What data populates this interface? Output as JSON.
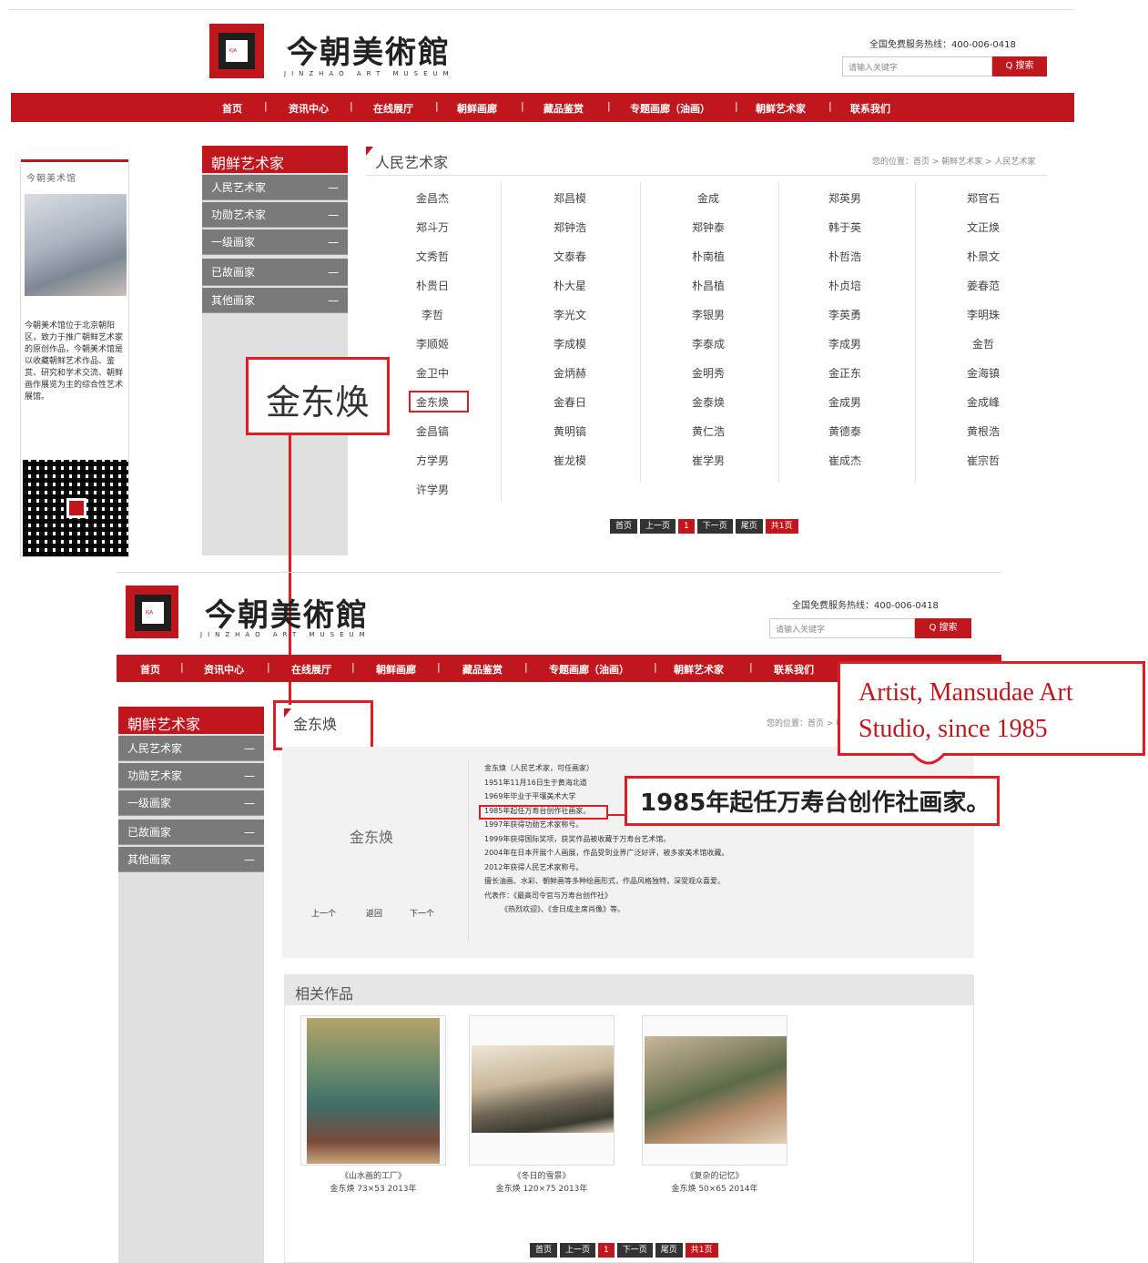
{
  "site": {
    "name": "今朝美術館",
    "name_sub": "JINZHAO ART MUSEUM",
    "logo_tag": "KJA",
    "hotline": "全国免费服务热线：400-006-0418",
    "search_placeholder": "请输入关键字",
    "search_button": "Q 搜索",
    "nav": [
      "首页",
      "资讯中心",
      "在线展厅",
      "朝鲜画廊",
      "藏品鉴赏",
      "专题画廊（油画）",
      "朝鲜艺术家",
      "联系我们"
    ]
  },
  "list_page": {
    "sidebar_title": "朝鲜艺术家",
    "sidebar_items": [
      "人民艺术家",
      "功勋艺术家",
      "一级画家",
      "已故画家",
      "其他画家"
    ],
    "content_title": "人民艺术家",
    "breadcrumb": "您的位置：首页 > 朝鲜艺术家 > 人民艺术家",
    "artists": [
      [
        "金昌杰",
        "郑昌模",
        "金成",
        "郑英男",
        "郑官石"
      ],
      [
        "郑斗万",
        "郑钟浩",
        "郑钟泰",
        "韩于英",
        "文正焕"
      ],
      [
        "文秀哲",
        "文泰春",
        "朴南植",
        "朴哲浩",
        "朴景文"
      ],
      [
        "朴贵日",
        "朴大星",
        "朴昌植",
        "朴贞培",
        "姜春范"
      ],
      [
        "李哲",
        "李光文",
        "李银男",
        "李英勇",
        "李明珠"
      ],
      [
        "李顺姬",
        "李成模",
        "李泰成",
        "李成男",
        "金哲"
      ],
      [
        "金卫中",
        "金炳赫",
        "金明秀",
        "金正东",
        "金海镇"
      ],
      [
        "金东焕",
        "金春日",
        "金泰焕",
        "金成男",
        "金成峰"
      ],
      [
        "金昌镐",
        "黄明镐",
        "黄仁浩",
        "黄德泰",
        "黄根浩"
      ],
      [
        "方学男",
        "崔龙模",
        "崔学男",
        "崔成杰",
        "崔宗哲"
      ],
      [
        "许学男"
      ]
    ],
    "pager": [
      "首页",
      "上一页",
      "1",
      "下一页",
      "尾页",
      "共1页"
    ],
    "left_widget_title": "今朝美术馆",
    "left_widget_text": "今朝美术馆位于北京朝阳区，致力于推广朝鲜艺术家的原创作品，今朝美术馆是以收藏朝鲜艺术作品、鉴赏、研究和学术交流、朝鲜画作展览为主的综合性艺术展馆。"
  },
  "annotations": {
    "highlight_name": "金东焕",
    "english_note": "Artist, Mansudae Art Studio, since 1985",
    "chinese_note": "1985年起任万寿台创作社画家。"
  },
  "detail_page": {
    "content_title": "金东焕",
    "breadcrumb": "您的位置：首页 > 朝鲜艺术家",
    "artist_name": "金东焕",
    "prev_label": "上一个",
    "back_label": "返回",
    "next_label": "下一个",
    "bio_lines": [
      "金东焕（人民艺术家，可任画家）",
      "1951年11月16日生于黄海北道",
      "1969年毕业于平壤美术大学",
      "1985年起任万寿台创作社画家。",
      "1997年获得功勋艺术家称号。",
      "1999年获得国际奖项，获奖作品被收藏于万寿台艺术馆。",
      "2004年在日本开展个人画展，作品受到业界广泛好评，被多家美术馆收藏。",
      "2012年获得人民艺术家称号。",
      "擅长油画、水彩、朝鲜画等多种绘画形式，作品风格独特，深受观众喜爱。",
      "代表作：《最高司令官与万寿台创作社》",
      "《热烈欢迎》、《金日成主席肖像》等。"
    ],
    "related_title": "相关作品",
    "works": [
      {
        "title": "《山水画的工厂》",
        "meta": "金东焕 73×53 2013年"
      },
      {
        "title": "《冬日的雪景》",
        "meta": "金东焕 120×75 2013年"
      },
      {
        "title": "《复杂的记忆》",
        "meta": "金东焕 50×65 2014年"
      }
    ],
    "pager": [
      "首页",
      "上一页",
      "1",
      "下一页",
      "尾页",
      "共1页"
    ]
  },
  "colors": {
    "brand_red": "#c0161d",
    "annotation_red": "#e31b22",
    "sidebar_gray": "#7a7a7a"
  }
}
